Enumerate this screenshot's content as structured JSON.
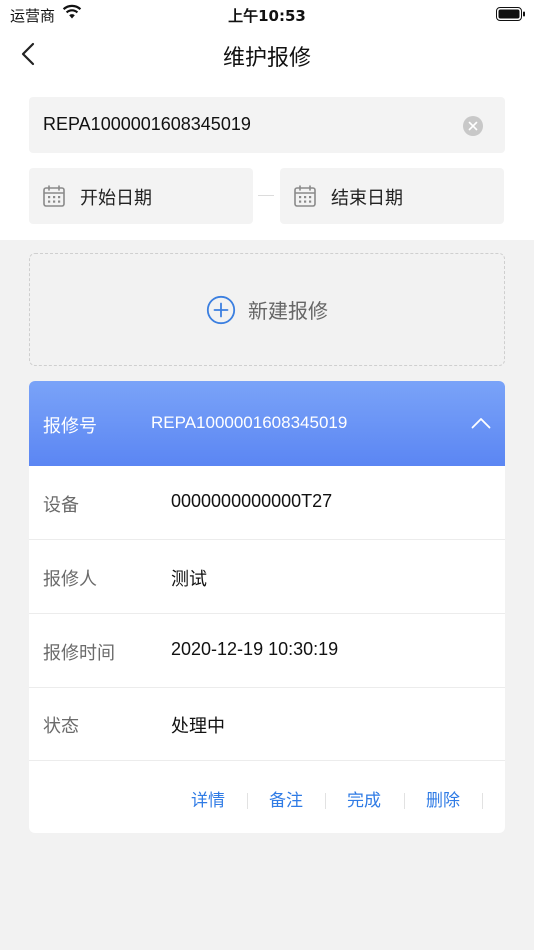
{
  "status_bar": {
    "carrier": "运营商",
    "time": "上午10:53"
  },
  "nav": {
    "title": "维护报修"
  },
  "search": {
    "value": "REPA1000001608345019"
  },
  "date_filter": {
    "start_placeholder": "开始日期",
    "end_placeholder": "结束日期"
  },
  "new_repair": {
    "label": "新建报修"
  },
  "card": {
    "header_label": "报修号",
    "header_value": "REPA1000001608345019",
    "rows": [
      {
        "label": "设备",
        "value": "0000000000000T27"
      },
      {
        "label": "报修人",
        "value": "测试"
      },
      {
        "label": "报修时间",
        "value": "2020-12-19 10:30:19"
      },
      {
        "label": "状态",
        "value": "处理中"
      }
    ],
    "actions": {
      "detail": "详情",
      "note": "备注",
      "complete": "完成",
      "delete": "删除"
    }
  },
  "colors": {
    "accent": "#2f7be5",
    "header_top": "#7aa3f8",
    "header_bottom": "#5b86f3",
    "page_bg": "#f2f2f2"
  }
}
